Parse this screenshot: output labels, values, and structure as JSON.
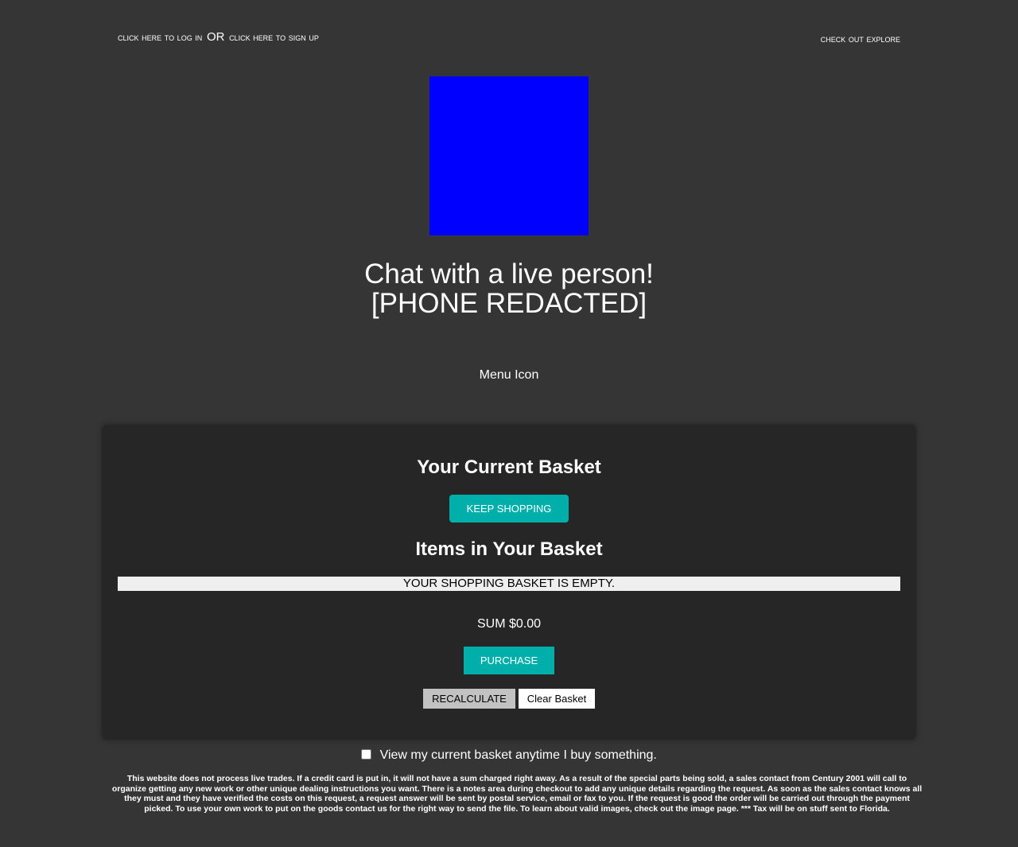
{
  "topbar": {
    "login_link": "click here to log in",
    "or_text": "OR",
    "signup_link": "click here to sign up",
    "explore_link": "check out explore"
  },
  "logo": {
    "color": "#0000ff"
  },
  "chat": {
    "line1": "Chat with a live person!",
    "line2": "[PHONE REDACTED]"
  },
  "menu": {
    "label": "Menu Icon"
  },
  "basket": {
    "title": "Your Current Basket",
    "keep_shopping": "KEEP SHOPPING",
    "items_title": "Items in Your Basket",
    "empty_message": "YOUR SHOPPING BASKET IS EMPTY.",
    "sum": "SUM $0.00",
    "purchase": "PURCHASE",
    "recalculate": "RECALCULATE",
    "clear": "Clear Basket"
  },
  "view_basket_option": {
    "label": "View my current basket anytime I buy something.",
    "checked": false
  },
  "disclaimer": "This website does not process live trades. If a credit card is put in, it will not have a sum charged right away. As a result of the special parts being sold, a sales contact from Century 2001 will call to organize getting any new work or other unique dealing instructions you want. There is a notes area during checkout to add any unique details regarding the request. As soon as the sales contact knows all they must and they have verified the costs on this request, a request answer will be sent by postal service, email or fax to you. If the request is good the order will be carried out through the payment picked. To use your own work to put on the goods contact us for the right way to send the file. To learn about valid images, check out the image page. *** Tax will be on stuff sent to Florida.",
  "colors": {
    "background": "#353535",
    "panel": "#262626",
    "accent": "#00aeaa"
  }
}
